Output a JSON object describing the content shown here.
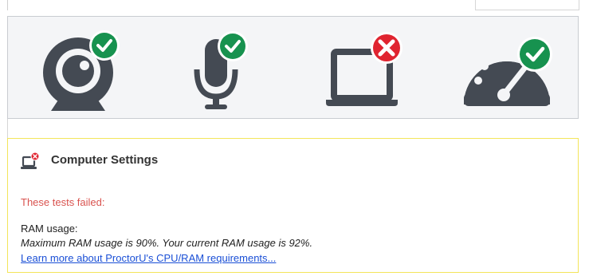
{
  "devices": [
    {
      "name": "webcam",
      "status": "pass"
    },
    {
      "name": "microphone",
      "status": "pass"
    },
    {
      "name": "computer",
      "status": "fail"
    },
    {
      "name": "speed",
      "status": "pass"
    }
  ],
  "colors": {
    "pass": "#17924f",
    "fail": "#e02430",
    "icon": "#444a53",
    "failed_text": "#d9534f",
    "link": "#1a4fd6",
    "box_border": "#f3e55a"
  },
  "settings": {
    "title": "Computer Settings",
    "icon": "laptop-fail-icon",
    "failed_label": "These tests failed:",
    "test_name": "RAM usage:",
    "test_detail": "Maximum RAM usage is 90%. Your current RAM usage is 92%.",
    "link_text": "Learn more about ProctorU's CPU/RAM requirements..."
  }
}
